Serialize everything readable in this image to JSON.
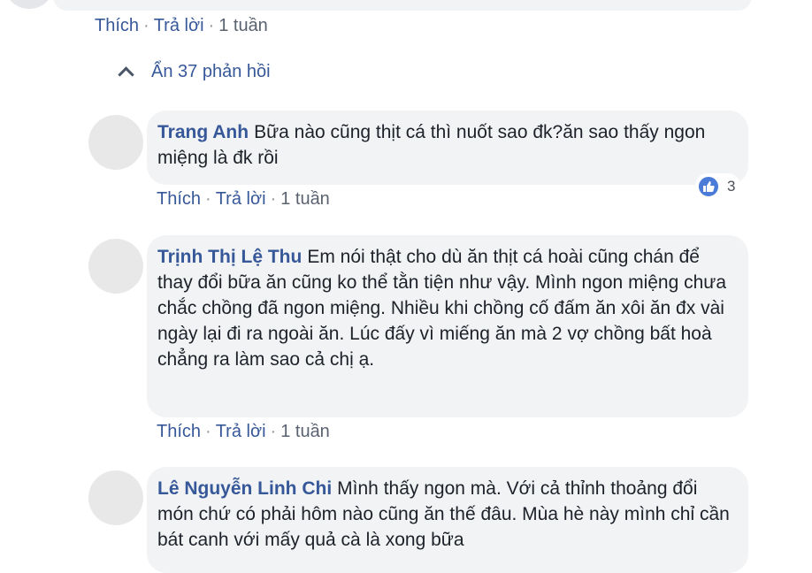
{
  "labels": {
    "like": "Thích",
    "reply": "Trả lời",
    "sep": "·"
  },
  "toggle_replies": "Ẩn 37 phản hồi",
  "top_comment": {
    "time": "1 tuần"
  },
  "replies": [
    {
      "author": "Trang Anh",
      "text": "Bữa nào cũng thịt cá thì nuốt sao đk?ăn sao thấy ngon miệng là đk rồi",
      "time": "1 tuần",
      "reactions": {
        "type": "like",
        "count": "3"
      }
    },
    {
      "author": "Trịnh Thị Lệ Thu",
      "text": "Em nói thật cho dù ăn thịt cá hoài cũng chán để thay đổi bữa ăn cũng ko thể tằn tiện như vậy. Mình ngon miệng chưa chắc chồng đã ngon miệng. Nhiều khi chồng cố đấm ăn xôi ăn đx vài ngày lại đi ra ngoài ăn. Lúc đấy vì miếng ăn mà 2 vợ chồng bất hoà chẳng ra làm sao cả chị ạ.",
      "time": "1 tuần"
    },
    {
      "author": "Lê Nguyễn Linh Chi",
      "text": "Mình thấy ngon mà. Với cả thỉnh thoảng đổi món chứ có phải hôm nào cũng ăn thế đâu. Mùa hè này mình chỉ cần bát canh với mấy quả cà là xong bữa"
    }
  ]
}
